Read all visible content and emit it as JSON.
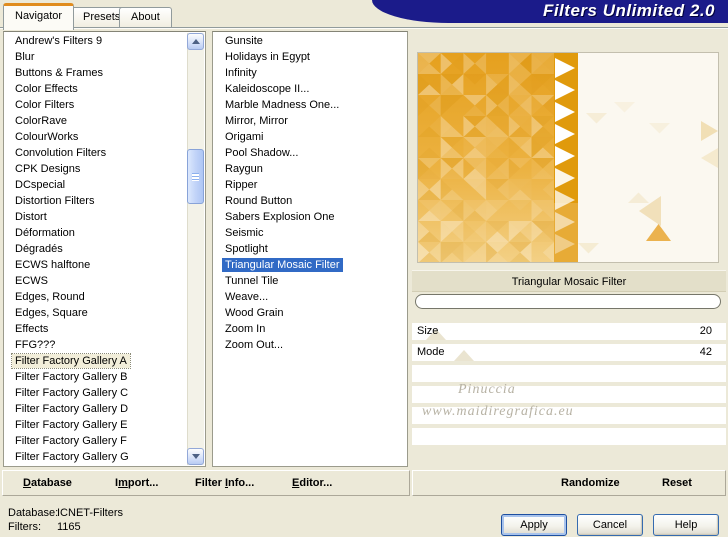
{
  "window": {
    "title": "Filters Unlimited 2.0"
  },
  "tabs": [
    {
      "label": "Navigator",
      "active": true
    },
    {
      "label": "Presets",
      "active": false
    },
    {
      "label": "About",
      "active": false
    }
  ],
  "category_list": {
    "items": [
      "Andrew's Filters 9",
      "Blur",
      "Buttons & Frames",
      "Color Effects",
      "Color Filters",
      "ColorRave",
      "ColourWorks",
      "Convolution Filters",
      "CPK Designs",
      "DCspecial",
      "Distortion Filters",
      "Distort",
      "Déformation",
      "Dégradés",
      "ECWS halftone",
      "ECWS",
      "Edges, Round",
      "Edges, Square",
      "Effects",
      "FFG???",
      {
        "label": "Filter Factory Gallery A",
        "selected": true
      },
      "Filter Factory Gallery B",
      "Filter Factory Gallery C",
      "Filter Factory Gallery D",
      "Filter Factory Gallery E",
      "Filter Factory Gallery F",
      "Filter Factory Gallery G"
    ]
  },
  "filter_list": {
    "items": [
      "Gunsite",
      "Holidays in Egypt",
      "Infinity",
      "Kaleidoscope II...",
      "Marble Madness One...",
      "Mirror, Mirror",
      "Origami",
      "Pool Shadow...",
      "Raygun",
      "Ripper",
      "Round Button",
      "Sabers Explosion One",
      "Seismic",
      "Spotlight",
      {
        "label": "Triangular Mosaic Filter",
        "selected": true
      },
      "Tunnel Tile",
      "Weave...",
      "Wood Grain",
      "Zoom In",
      "Zoom Out..."
    ]
  },
  "preview": {
    "caption": "Triangular Mosaic Filter",
    "watermark_line1": "Pinuccia",
    "watermark_line2": "www.maidiregrafica.eu",
    "palette": {
      "amber_dark": "#e5a01e",
      "amber_mid": "#ecb241",
      "amber_light": "#f3d085",
      "strip_orange": "#e09a0c",
      "near_white": "#fbf8f0",
      "selection_blue": "#316ac5",
      "banner_navy": "#1b1b8a",
      "tab_accent_orange": "#e08c1e"
    }
  },
  "params": [
    {
      "name": "Size",
      "value": 20,
      "max": 255
    },
    {
      "name": "Mode",
      "value": 42,
      "max": 255
    }
  ],
  "toolbar": {
    "database": "Database",
    "import": "Import...",
    "filter_info": "Filter Info...",
    "editor": "Editor...",
    "randomize": "Randomize",
    "reset": "Reset"
  },
  "status": {
    "database_label": "Database:",
    "database_value": "ICNET-Filters",
    "filters_label": "Filters:",
    "filters_value": "1165"
  },
  "buttons": {
    "apply": "Apply",
    "cancel": "Cancel",
    "help": "Help"
  }
}
